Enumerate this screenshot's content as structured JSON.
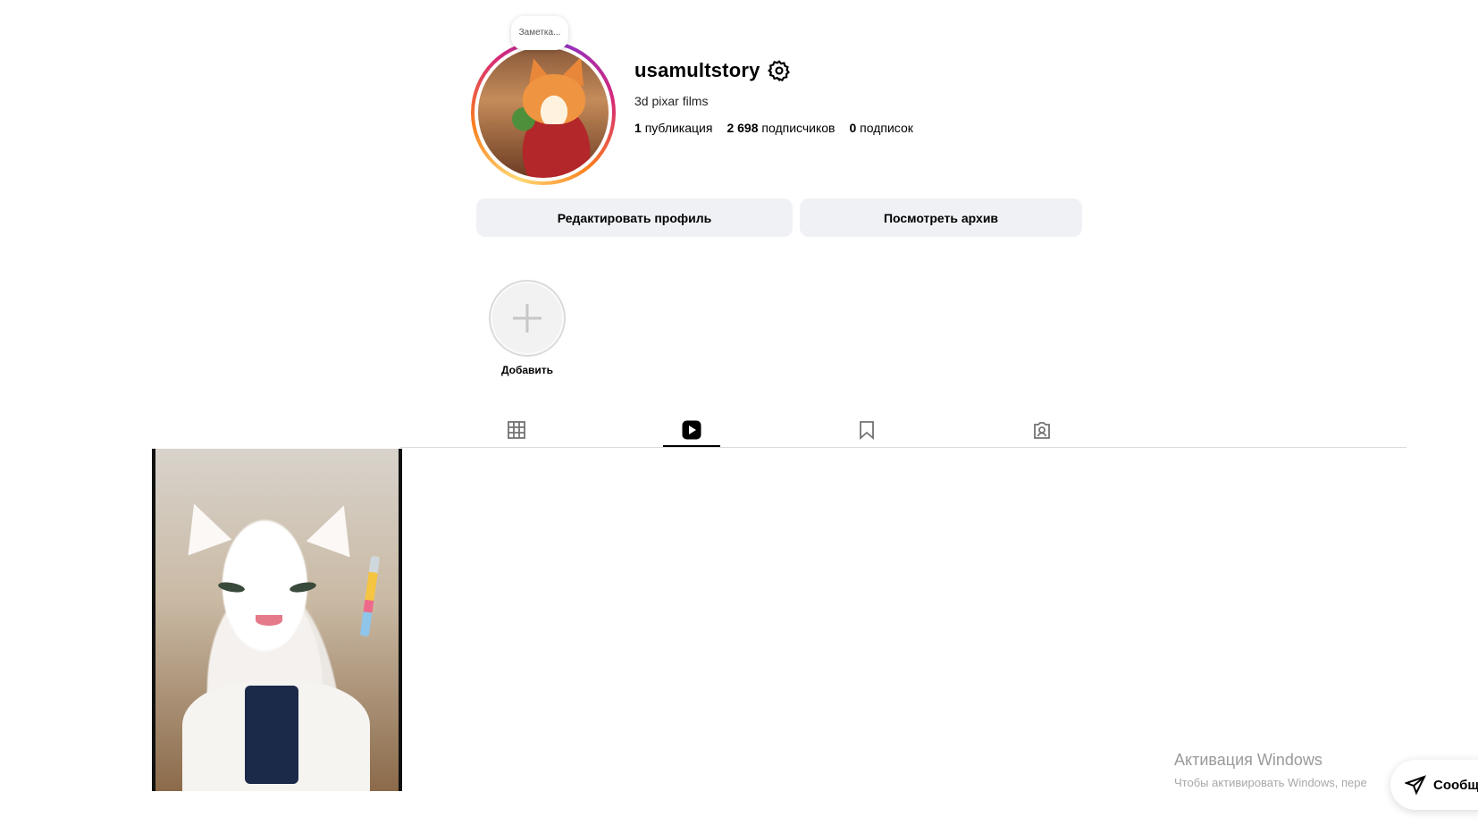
{
  "profile": {
    "note": "Заметка...",
    "username": "usamultstory",
    "bio": "3d pixar films",
    "stats": {
      "posts_count": "1",
      "posts_label": "публикация",
      "followers_count": "2 698",
      "followers_label": "подписчиков",
      "following_count": "0",
      "following_label": "подписок"
    }
  },
  "actions": {
    "edit_profile": "Редактировать профиль",
    "view_archive": "Посмотреть архив"
  },
  "highlights": {
    "add_label": "Добавить"
  },
  "tabs": {
    "active": "reels",
    "items": [
      {
        "id": "posts",
        "icon": "grid-icon"
      },
      {
        "id": "reels",
        "icon": "reels-icon"
      },
      {
        "id": "saved",
        "icon": "bookmark-icon"
      },
      {
        "id": "tagged",
        "icon": "tagged-icon"
      }
    ]
  },
  "watermark": {
    "title": "Активация Windows",
    "subtitle": "Чтобы активировать Windows, пере"
  },
  "messages": {
    "label": "Сообще"
  },
  "colors": {
    "button_bg": "#eff1f4",
    "divider": "#dbdbdb",
    "story_ring": [
      "#feda75",
      "#fa7e1e",
      "#d62976",
      "#962fbf"
    ]
  }
}
